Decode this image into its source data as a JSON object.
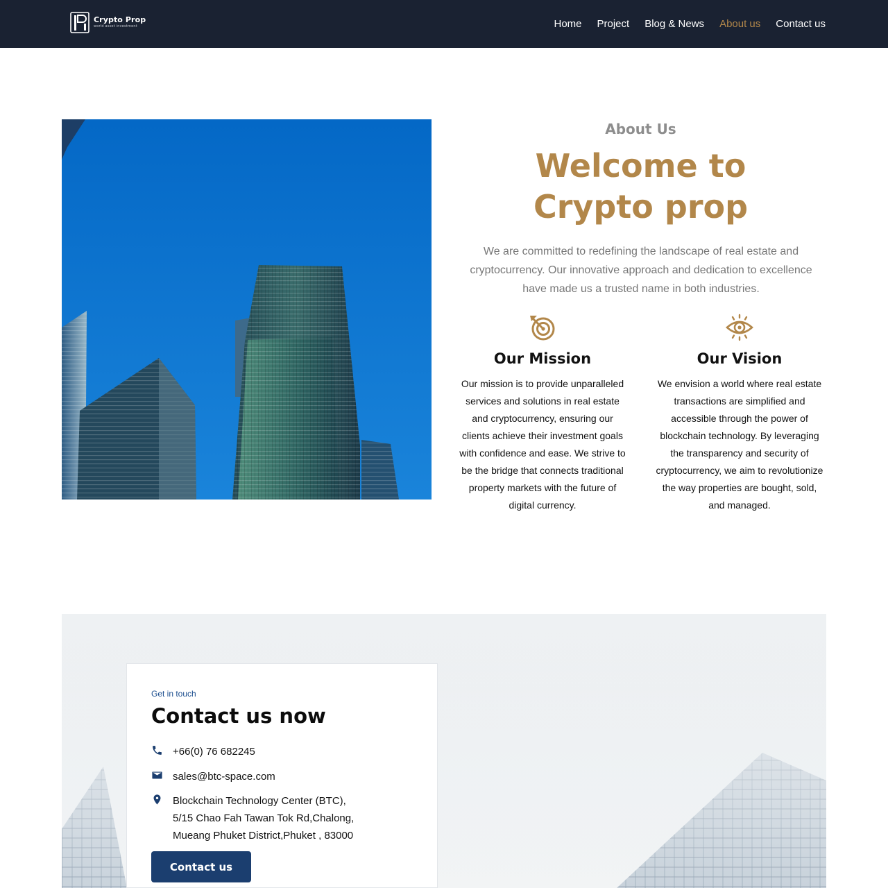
{
  "header": {
    "logo": {
      "name": "Crypto Prop",
      "tagline": "world asset investment"
    },
    "nav": [
      {
        "label": "Home",
        "active": false
      },
      {
        "label": "Project",
        "active": false
      },
      {
        "label": "Blog & News",
        "active": false
      },
      {
        "label": "About us",
        "active": true
      },
      {
        "label": "Contact us",
        "active": false
      }
    ]
  },
  "about": {
    "eyebrow": "About Us",
    "title_lines": [
      "Welcome to",
      "Crypto prop"
    ],
    "intro": "We are committed to redefining the landscape of real estate and cryptocurrency. Our innovative approach and dedication to excellence have made us a trusted name in both industries.",
    "mission": {
      "icon": "target-arrow-icon",
      "title": "Our Mission",
      "text": "Our mission is to provide unparalleled services and solutions in real estate and cryptocurrency, ensuring our clients achieve their investment goals with confidence and ease. We strive to be the bridge that connects traditional property markets with the future of digital currency."
    },
    "vision": {
      "icon": "eye-icon",
      "title": "Our Vision",
      "text": "We envision a world where real estate transactions are simplified and accessible through the power of blockchain technology. By leveraging the transparency and security of cryptocurrency, we aim to revolutionize the way properties are bought, sold, and managed."
    }
  },
  "contact": {
    "eyebrow": "Get in touch",
    "title": "Contact us now",
    "phone": "+66(0) 76 682245",
    "email": "sales@btc-space.com",
    "address_lines": [
      "Blockchain Technology Center (BTC),",
      "5/15 Chao Fah Tawan Tok Rd,Chalong,",
      "Mueang Phuket District,Phuket , 83000"
    ],
    "button_label": "Contact us"
  },
  "colors": {
    "nav_background": "#1a2232",
    "accent_gold": "#b2874a",
    "button_navy": "#1b3e6f",
    "link_blue": "#1d4f8f"
  }
}
